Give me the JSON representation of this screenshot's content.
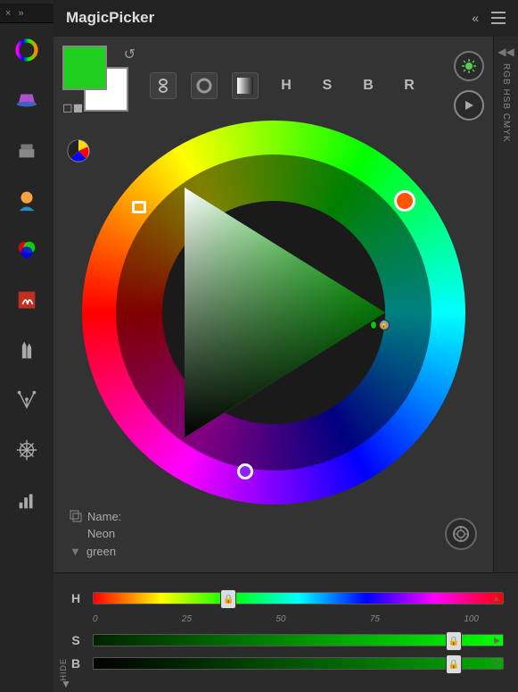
{
  "title": "MagicPicker",
  "right_strip_label": "RGB HSB CMYK",
  "mode_buttons": {
    "h": "H",
    "s": "S",
    "b": "B",
    "r": "R"
  },
  "swatch": {
    "foreground": "#1fd01f",
    "background": "#ffffff"
  },
  "name": {
    "label": "Name:",
    "value_line1": "Neon",
    "value_line2": "green"
  },
  "sliders": {
    "h": {
      "label": "H",
      "value": 33
    },
    "s": {
      "label": "S",
      "value": 88
    },
    "b": {
      "label": "B",
      "value": 88
    },
    "ticks": {
      "t0": "0",
      "t25": "25",
      "t50": "50",
      "t75": "75",
      "t100": "100"
    },
    "hide_label": "HIDE"
  }
}
